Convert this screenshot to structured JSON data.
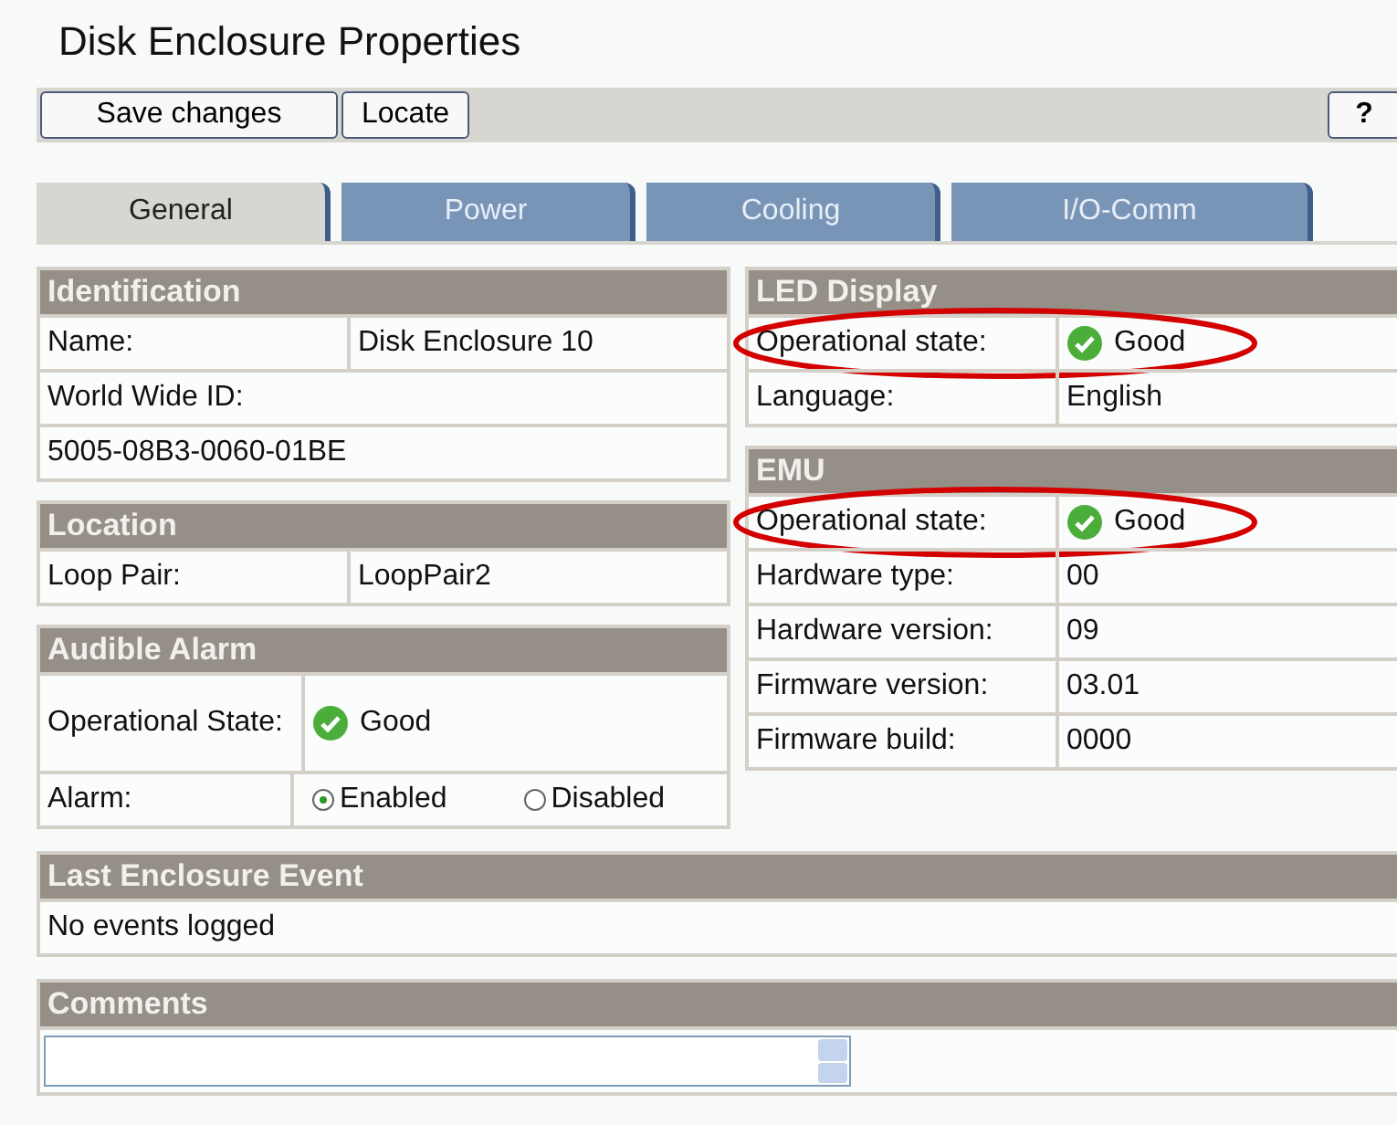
{
  "title": "Disk Enclosure Properties",
  "toolbar": {
    "buttons": [
      "Save changes",
      "Locate"
    ],
    "help": "?"
  },
  "tabs": [
    {
      "label": "General",
      "selected": true
    },
    {
      "label": "Power",
      "selected": false
    },
    {
      "label": "Cooling",
      "selected": false
    },
    {
      "label": "I/O-Comm",
      "selected": false
    }
  ],
  "left": [
    {
      "title": "Identification",
      "rows": [
        {
          "kind": "pair",
          "label": "Name:",
          "value": "Disk Enclosure 10"
        },
        {
          "kind": "full",
          "label": "World Wide ID:"
        },
        {
          "kind": "full",
          "label": "5005-08B3-0060-01BE"
        }
      ]
    },
    {
      "title": "Location",
      "rows": [
        {
          "kind": "pair",
          "label": "Loop Pair:",
          "value": "LoopPair2"
        }
      ]
    },
    {
      "title": "Audible Alarm",
      "rows": [
        {
          "kind": "status",
          "label": "Operational State:",
          "value": "Good"
        },
        {
          "kind": "radio",
          "label": "Alarm:",
          "options": [
            {
              "label": "Enabled",
              "selected": true
            },
            {
              "label": "Disabled",
              "selected": false
            }
          ]
        }
      ]
    }
  ],
  "right": [
    {
      "title": "LED Display",
      "rows": [
        {
          "kind": "status",
          "label": "Operational state:",
          "value": "Good",
          "highlighted": true
        },
        {
          "kind": "pair",
          "label": "Language:",
          "value": "English"
        }
      ]
    },
    {
      "title": "EMU",
      "rows": [
        {
          "kind": "status",
          "label": "Operational state:",
          "value": "Good",
          "highlighted": true
        },
        {
          "kind": "pair",
          "label": "Hardware type:",
          "value": "00"
        },
        {
          "kind": "pair",
          "label": "Hardware version:",
          "value": "09"
        },
        {
          "kind": "pair",
          "label": "Firmware version:",
          "value": "03.01"
        },
        {
          "kind": "pair",
          "label": "Firmware build:",
          "value": "0000"
        }
      ]
    }
  ],
  "last_event": {
    "title": "Last Enclosure Event",
    "text": "No events logged"
  },
  "comments": {
    "title": "Comments"
  }
}
